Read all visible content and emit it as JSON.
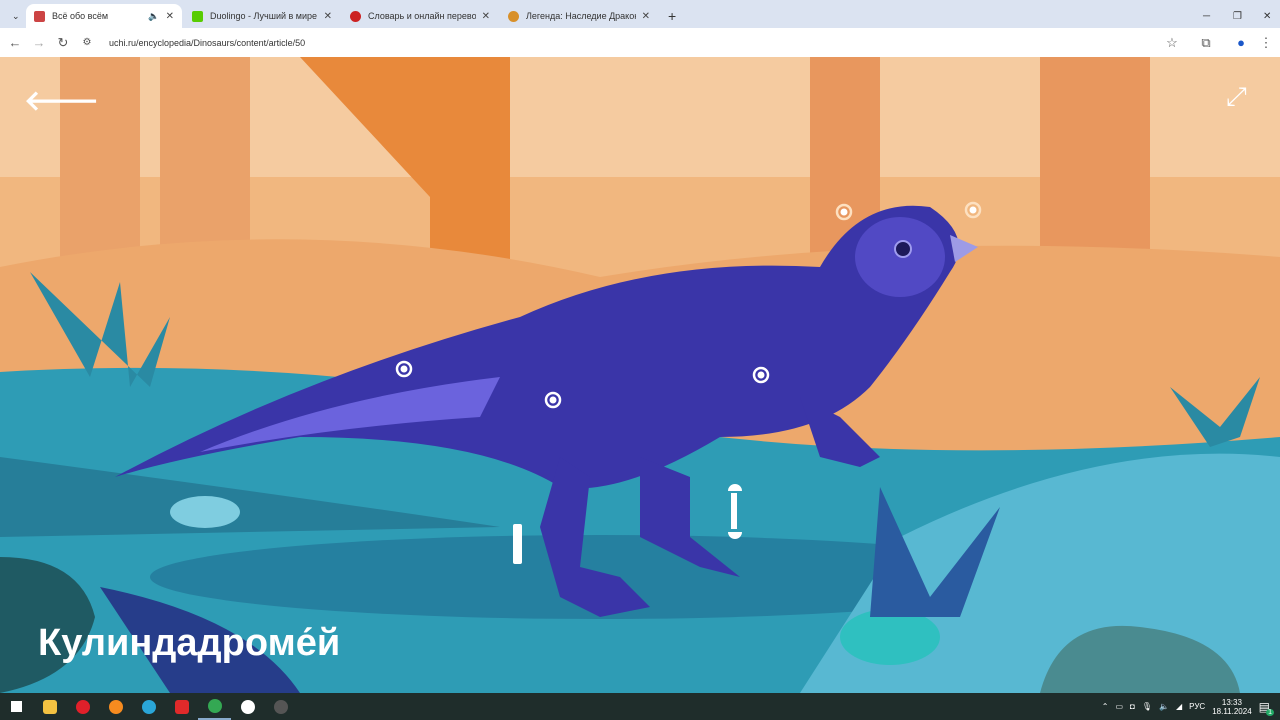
{
  "browser": {
    "tabs": [
      {
        "label": "Всё обо всём",
        "active": true
      },
      {
        "label": "Duolingo - Лучший в мире сп"
      },
      {
        "label": "Словарь и онлайн перевод н"
      },
      {
        "label": "Легенда: Наследие Драконов"
      }
    ],
    "url": "uchi.ru/encyclopedia/Dinosaurs/content/article/50"
  },
  "page": {
    "title": "Кулиндадроме́й"
  },
  "tray": {
    "lang": "РУС",
    "time": "13:33",
    "date": "18.11.2024",
    "notifications": "1"
  }
}
